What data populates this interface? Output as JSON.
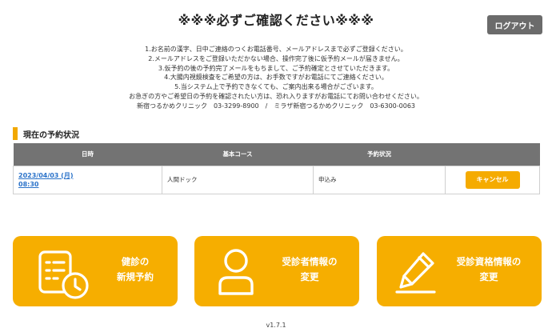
{
  "header": {
    "title": "※※※必ずご確認ください※※※",
    "logout_label": "ログアウト"
  },
  "notice": {
    "lines": [
      "1.お名前の漢字、日中ご連絡のつくお電話番号、メールアドレスまで必ずご登録ください。",
      "2.メールアドレスをご登録いただかない場合、操作完了後に仮予約メールが届きません。",
      "3.仮予約の後の予約完了メールをもちまして、ご予約確定とさせていただきます。",
      "4.大腸内視鏡検査をご希望の方は、お手数ですがお電話にてご連絡ください。",
      "5.当システム上で予約できなくても、ご案内出来る場合がございます。",
      "お急ぎの方やご希望日の予約を確認されたい方は、恐れ入りますがお電話にてお問い合わせください。",
      "新宿つるかめクリニック　03-3299-8900　/　ミラザ新宿つるかめクリニック　03-6300-0063"
    ]
  },
  "reservations": {
    "heading": "現在の予約状況",
    "columns": [
      "日時",
      "基本コース",
      "予約状況",
      ""
    ],
    "rows": [
      {
        "date": "2023/04/03 (月)",
        "time": "08:30",
        "course": "人間ドック",
        "status": "申込み",
        "action_label": "キャンセル"
      }
    ]
  },
  "tiles": [
    {
      "icon": "clipboard-clock-icon",
      "lines": [
        "健診の",
        "新規予約"
      ]
    },
    {
      "icon": "user-icon",
      "lines": [
        "受診者情報の",
        "変更"
      ]
    },
    {
      "icon": "pencil-icon",
      "lines": [
        "受診資格情報の",
        "変更"
      ]
    }
  ],
  "footer": {
    "version": "v1.7.1"
  },
  "colors": {
    "accent": "#f6ae00",
    "table_header": "#737373",
    "logout": "#6b6b6b",
    "link": "#2a72c9"
  }
}
